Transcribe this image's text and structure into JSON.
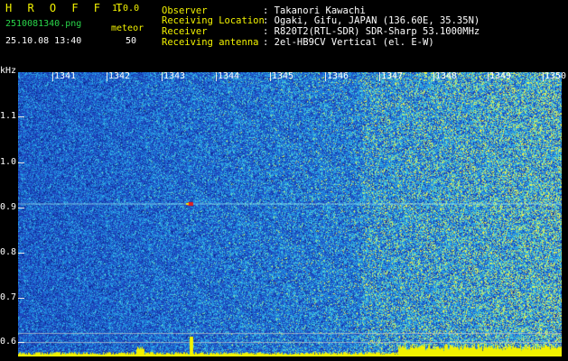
{
  "header": {
    "brand": "H R O F F T",
    "version": "1.0.0",
    "filename": "2510081340.png",
    "meteor_label": "meteor",
    "datetime": "25.10.08 13:40",
    "meteor_count": "50",
    "fields": [
      {
        "label": "Observer",
        "value": ": Takanori Kawachi"
      },
      {
        "label": "Receiving Location",
        "value": ": Ogaki, Gifu, JAPAN (136.60E, 35.35N)"
      },
      {
        "label": "Receiver",
        "value": ": R820T2(RTL-SDR) SDR-Sharp 53.1000MHz"
      },
      {
        "label": "Receiving antenna",
        "value": ": 2el-HB9CV Vertical (el. E-W)"
      }
    ]
  },
  "axes": {
    "y_unit": "kHz",
    "x_ticks": [
      "1341",
      "1342",
      "1343",
      "1344",
      "1345",
      "1346",
      "1347",
      "1348",
      "1349",
      "1350"
    ],
    "y_ticks": [
      "1.1",
      "1.0",
      "0.9",
      "0.8",
      "0.7",
      "0.6"
    ]
  },
  "colors": {
    "text_yellow": "#f2f200",
    "text_green": "#29d64a",
    "background_signal": "#1e3fb4",
    "noise_cyan": "#2ca0d8",
    "signal_yellow": "#f2f200",
    "signal_red": "#e02020"
  }
}
